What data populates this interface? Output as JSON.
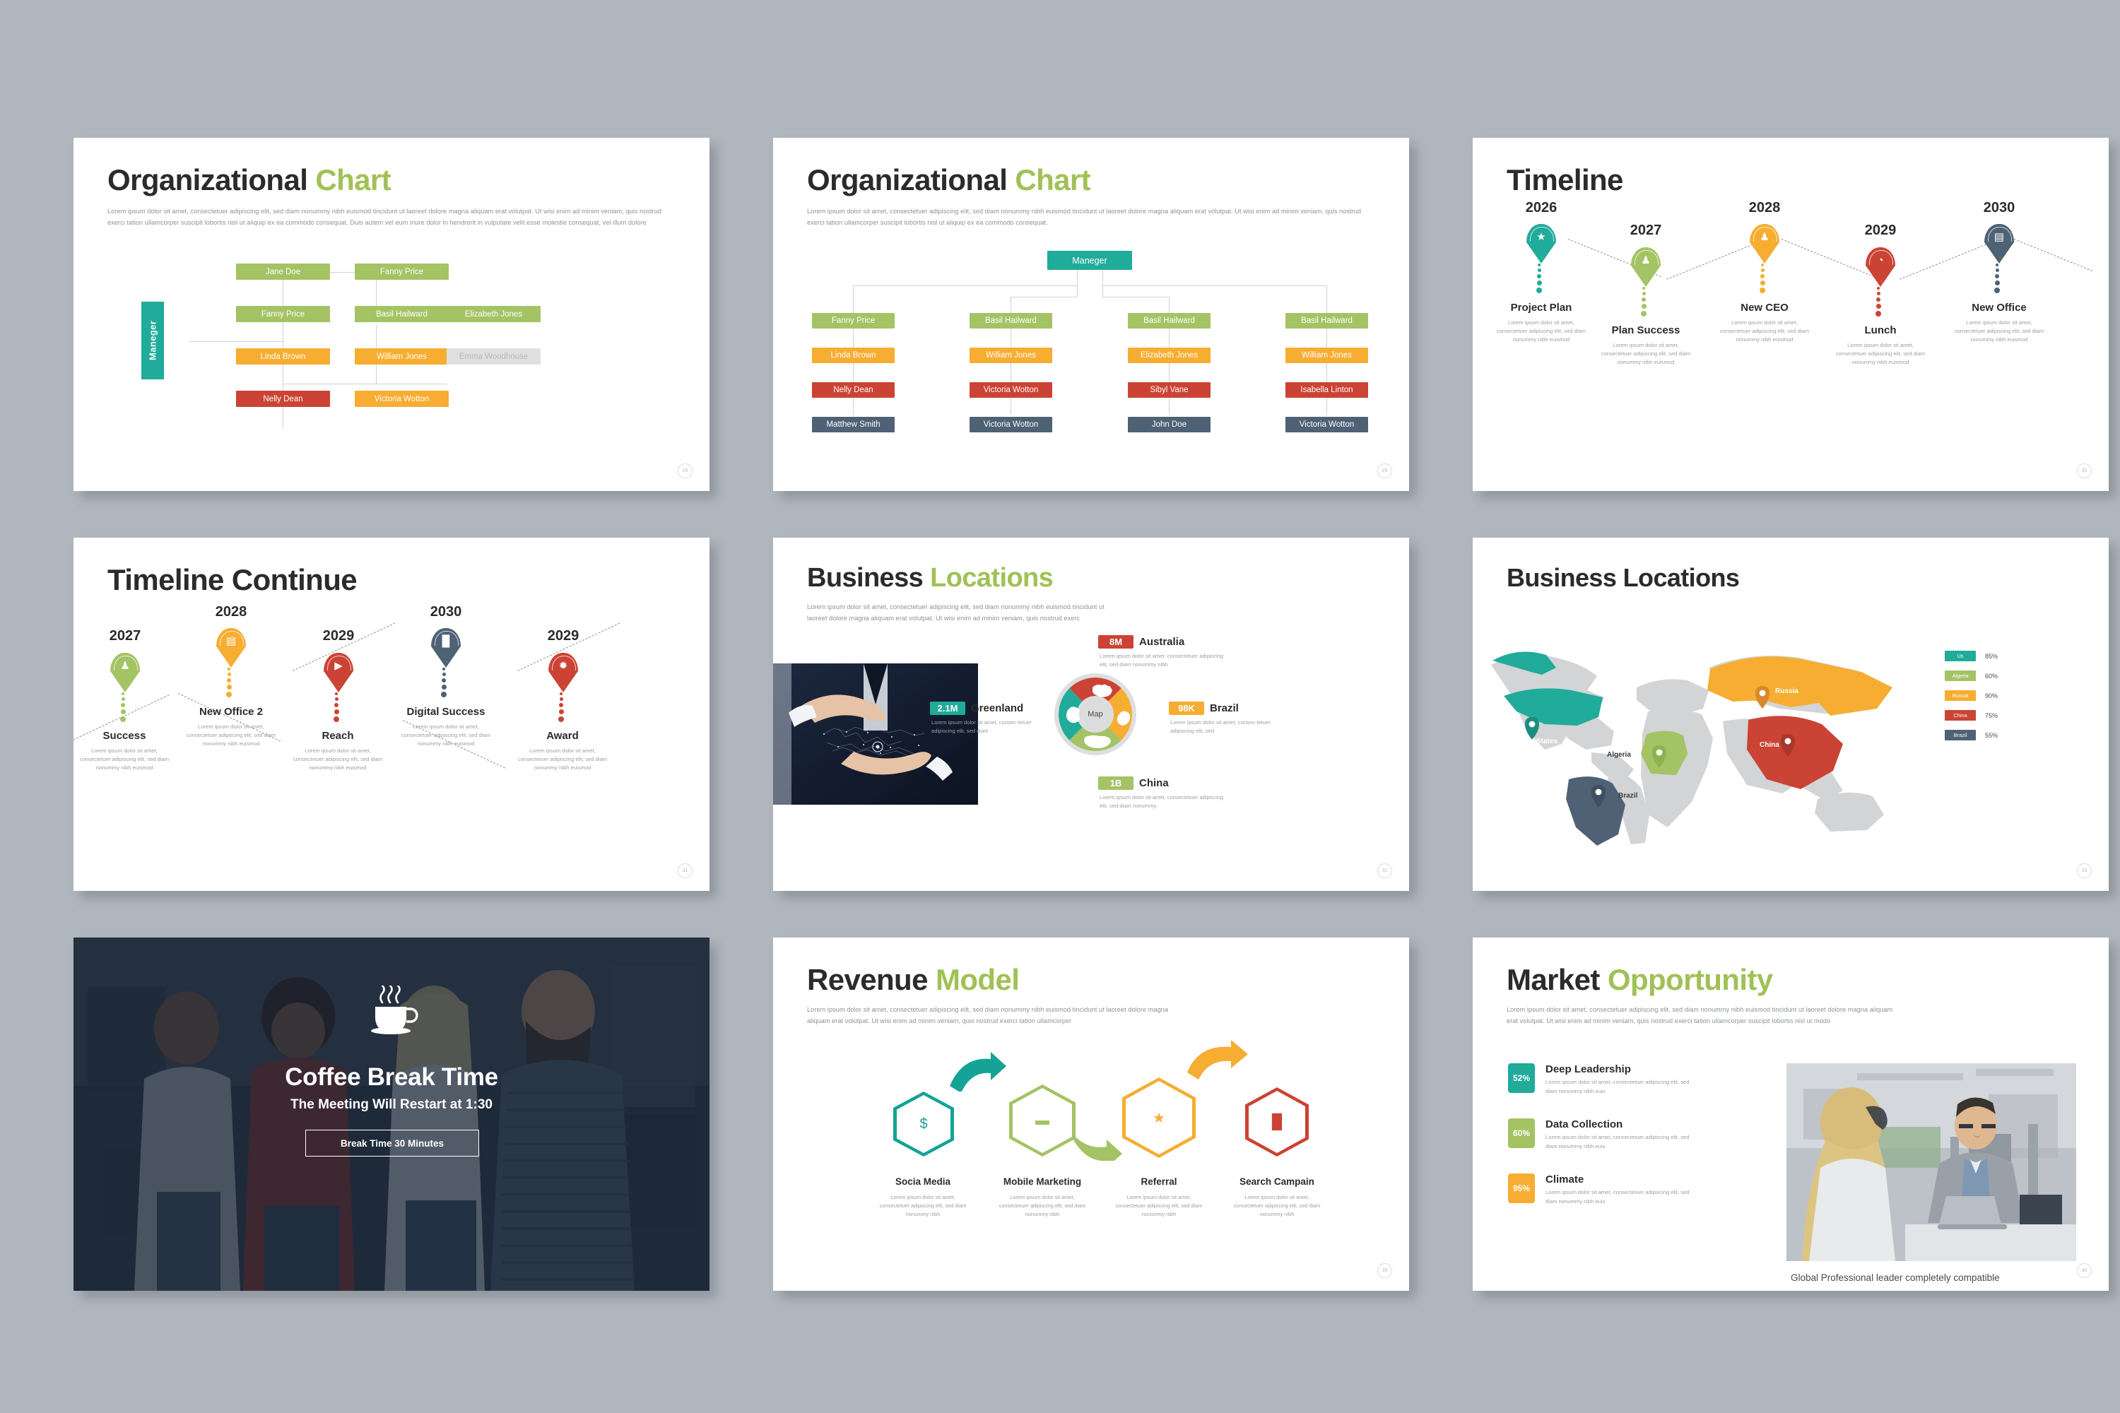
{
  "theme": {
    "teal": "#20ab9b",
    "green": "#a4c364",
    "orange": "#f6ad31",
    "red": "#cb4334",
    "slate": "#4f6175",
    "grey": "#e0e0e0",
    "accent_title": "#a0c156",
    "background": "#b0b6bd"
  },
  "slides": [
    {
      "id": "org-chart-1",
      "page": "28",
      "title_main": "Organizational",
      "title_accent": "Chart",
      "body": "Lorem ipsum dolor sit amet, consectetuer adipiscing elit, sed diam nonummy nibh euismod tincidunt ut laoreet dolore magna aliquam erat volutpat. Ut wisi enim ad minim veniam, quis nostrud exerci tation ullamcorper suscipit lobortis nisl ut aliquip ex ea commodo consequat. Duis autem vel eum iriure dolor in hendrerit in vulputate velit esse molestie consequat, vel illum dolore",
      "manager_label": "Maneger",
      "nodes": [
        {
          "label": "Jane Doe",
          "color": "green"
        },
        {
          "label": "Fanny Price",
          "color": "green"
        },
        {
          "label": "Elizabeth Jones",
          "color": "green"
        },
        {
          "label": "Fanny Price",
          "color": "green"
        },
        {
          "label": "Basil Hailward",
          "color": "green"
        },
        {
          "label": "Linda Brown",
          "color": "orange"
        },
        {
          "label": "William Jones",
          "color": "orange"
        },
        {
          "label": "Emma Woodhouse",
          "color": "grey"
        },
        {
          "label": "Nelly Dean",
          "color": "red"
        },
        {
          "label": "Victoria Wotton",
          "color": "orange"
        }
      ]
    },
    {
      "id": "org-chart-2",
      "page": "29",
      "title_main": "Organizational",
      "title_accent": "Chart",
      "body": "Lorem ipsum dolor sit amet, consectetuer adipiscing elit, sed diam nonummy nibh euismod tincidunt ut laoreet dolore magna aliquam erat volutpat. Ut wisi enim ad minim veniam, quis nostrud exerci tation ullamcorper suscipit lobortis nisl ut aliquip ex ea commodo consequat.",
      "root": "Maneger",
      "columns": [
        {
          "green": "Fanny Price",
          "orange": "Linda Brown",
          "red": "Nelly Dean",
          "slate": "Matthew Smith"
        },
        {
          "green": "Basil Hailward",
          "orange": "William Jones",
          "red": "Victoria Wotton",
          "slate": "Victoria Wotton"
        },
        {
          "green": "Basil Hailward",
          "orange": "Elizabeth Jones",
          "red": "Sibyl Vane",
          "slate": "John Doe"
        },
        {
          "green": "Basil Hailward",
          "orange": "William Jones",
          "red": "Isabella Linton",
          "slate": "Victoria Wotton"
        }
      ]
    },
    {
      "id": "timeline",
      "page": "30",
      "title_main": "Timeline",
      "items": [
        {
          "year": "2026",
          "label": "Project Plan",
          "icon": "handshake-award-icon",
          "glyph": "★",
          "color": "teal",
          "desc": "Lorem ipsum dolor sit amet, consectetuer adipiscing elit, sed diam nonummy nibh euismod"
        },
        {
          "year": "2027",
          "label": "Plan Success",
          "icon": "trophy-person-icon",
          "glyph": "♟",
          "color": "green",
          "desc": "Lorem ipsum dolor sit amet, consectetuer adipiscing elit, sed diam nonummy nibh euismod"
        },
        {
          "year": "2028",
          "label": "New CEO",
          "icon": "podium-speaker-icon",
          "glyph": "♟",
          "color": "orange",
          "desc": "Lorem ipsum dolor sit amet, consectetuer adipiscing elit, sed diam nonummy nibh euismod"
        },
        {
          "year": "2029",
          "label": "Lunch",
          "icon": "rocket-launch-icon",
          "glyph": "◔",
          "color": "red",
          "desc": "Lorem ipsum dolor sit amet, consectetuer adipiscing elit, sed diam nonummy nibh euismod"
        },
        {
          "year": "2030",
          "label": "New Office",
          "icon": "building-icon",
          "glyph": "▤",
          "color": "slate",
          "desc": "Lorem ipsum dolor sit amet, consectetuer adipiscing elit, sed diam nonummy nibh euismod"
        }
      ]
    },
    {
      "id": "timeline-continue",
      "page": "31",
      "title_main": "Timeline Continue",
      "items": [
        {
          "year": "2027",
          "label": "Success",
          "icon": "person-flag-icon",
          "glyph": "♟",
          "color": "green",
          "desc": "Lorem ipsum dolor sit amet, consectetuer adipiscing elit, sed diam nonummy nibh euismod"
        },
        {
          "year": "2028",
          "label": "New Office 2",
          "icon": "briefcase-icon",
          "glyph": "▤",
          "color": "orange",
          "desc": "Lorem ipsum dolor sit amet, consectetuer adipiscing elit, sed diam nonummy nibh euismod"
        },
        {
          "year": "2029",
          "label": "Reach",
          "icon": "megaphone-icon",
          "glyph": "▶",
          "color": "red",
          "desc": "Lorem ipsum dolor sit amet, consectetuer adipiscing elit, sed diam nonummy nibh euismod"
        },
        {
          "year": "2030",
          "label": "Digital Success",
          "icon": "bar-chart-icon",
          "glyph": "█",
          "color": "slate",
          "desc": "Lorem ipsum dolor sit amet, consectetuer adipiscing elit, sed diam nonummy nibh euismod"
        },
        {
          "year": "2029",
          "label": "Award",
          "icon": "medal-ribbon-icon",
          "glyph": "✹",
          "color": "red",
          "desc": "Lorem ipsum dolor sit amet, consectetuer adipiscing elit, sed diam nonummy nibh euismod"
        }
      ]
    },
    {
      "id": "business-locations-donut",
      "page": "32",
      "title_main": "Business",
      "title_accent": "Locations",
      "body": "Lorem ipsum dolor sit amet, consectetuer adipiscing elit, sed diam nonummy nibh euismod tincidunt ut laoreet dolore magna aliquam erat volutpat. Ut wisi enim ad minim veniam, quis nostrud exerc",
      "hub_label": "Map",
      "segments": [
        {
          "value": "8M",
          "name": "Australia",
          "color": "red",
          "desc": "Lorem ipsum dolor sit amet, consectetuer adipiscing elit, sed diam nonummy nibh"
        },
        {
          "value": "98K",
          "name": "Brazil",
          "color": "orange",
          "desc": "Lorem ipsum dolor sit amet, consec-tetuer adipiscing elit, sed"
        },
        {
          "value": "1B",
          "name": "China",
          "color": "green",
          "desc": "Lorem ipsum dolor sit amet, consectetuer adipiscing elit, sed diam nonummy"
        },
        {
          "value": "2.1M",
          "name": "Greenland",
          "color": "teal",
          "desc": "Lorem ipsum dolor sit amet, consec-tetuer adipiscing elit, sed diam"
        }
      ]
    },
    {
      "id": "business-locations-map",
      "page": "33",
      "title_main": "Business Locations",
      "map_labels": [
        {
          "name": "United States",
          "color": "teal"
        },
        {
          "name": "Algeria",
          "color": "green"
        },
        {
          "name": "Russia",
          "color": "orange"
        },
        {
          "name": "China",
          "color": "red"
        },
        {
          "name": "Brazil",
          "color": "slate"
        }
      ],
      "legend": [
        {
          "label": "Us",
          "pct": "85%",
          "color": "teal"
        },
        {
          "label": "Algeria",
          "pct": "60%",
          "color": "green"
        },
        {
          "label": "Russia",
          "pct": "90%",
          "color": "orange"
        },
        {
          "label": "China",
          "pct": "75%",
          "color": "red"
        },
        {
          "label": "Brazil",
          "pct": "55%",
          "color": "slate"
        }
      ]
    },
    {
      "id": "coffee-break",
      "title": "Coffee Break Time",
      "subtitle": "The Meeting Will Restart at 1:30",
      "button": "Break Time 30 Minutes",
      "icon": "coffee-cup-icon"
    },
    {
      "id": "revenue-model",
      "page": "35",
      "title_main": "Revenue",
      "title_accent": "Model",
      "body": "Lorem ipsum dolor sit amet, consectetuer adipiscing elit, sed diam nonummy nibh euismod tincidunt ut laoreet dolore magna aliquam erat volutpat. Ut wisi enim ad minim veniam, quis nostrud exerci tation ullamcorper",
      "steps": [
        {
          "name": "Socia Media",
          "icon": "money-hand-icon",
          "glyph": "$",
          "color": "teal",
          "desc": "Lorem ipsum dolor sit amet, consectetuer adipiscing elit, sed diam nonummy nibh"
        },
        {
          "name": "Mobile Marketing",
          "icon": "briefcase-icon",
          "glyph": "▬",
          "color": "green",
          "desc": "Lorem ipsum dolor sit amet, consectetuer adipiscing elit, sed diam nonummy nibh"
        },
        {
          "name": "Referral",
          "icon": "handshake-stars-icon",
          "glyph": "★",
          "color": "orange",
          "desc": "Lorem ipsum dolor sit amet, consectetuer adipiscing elit, sed diam nonummy nibh"
        },
        {
          "name": "Search Campain",
          "icon": "growth-chart-icon",
          "glyph": "█",
          "color": "red",
          "desc": "Lorem ipsum dolor sit amet, consectetuer adipiscing elit, sed diam nonummy nibh"
        }
      ]
    },
    {
      "id": "market-opportunity",
      "page": "36",
      "title_main": "Market",
      "title_accent": "Opportunity",
      "body": "Lorem ipsum dolor sit amet, consectetuer adipiscing elit, sed diam nonummy nibh euismod tincidunt ut laoreet dolore magna aliquam erat volutpat. Ut wisi enim ad minim veniam, quis nostrud exerci tation ullamcorper suscipit lobortis nisl ut modo",
      "caption": "Global Professional leader completely compatible",
      "metrics": [
        {
          "pct": "52%",
          "title": "Deep Leadership",
          "color": "teal",
          "desc": "Lorem ipsum dolor sit amet, consectetuer adipiscing elit, sed diam nonummy nibh euis"
        },
        {
          "pct": "60%",
          "title": "Data Collection",
          "color": "green",
          "desc": "Lorem ipsum dolor sit amet, consectetuer adipiscing elit, sed diam nonummy nibh euis"
        },
        {
          "pct": "95%",
          "title": "Climate",
          "color": "orange",
          "desc": "Lorem ipsum dolor sit amet, consectetuer adipiscing elit, sed diam nonummy nibh euis"
        }
      ]
    }
  ],
  "chart_data": [
    {
      "type": "pie",
      "title": "Business Locations",
      "categories": [
        "Australia",
        "Brazil",
        "China",
        "Greenland"
      ],
      "labels": [
        "8M",
        "98K",
        "1B",
        "2.1M"
      ],
      "values": [
        25,
        25,
        25,
        25
      ],
      "colors": [
        "#cb4334",
        "#f6ad31",
        "#a4c364",
        "#20ab9b"
      ],
      "center_label": "Map",
      "legend": "around"
    },
    {
      "type": "bar",
      "title": "Business Locations coverage",
      "categories": [
        "Us",
        "Algeria",
        "Russia",
        "China",
        "Brazil"
      ],
      "values": [
        85,
        60,
        90,
        75,
        55
      ],
      "ylabel": "%",
      "ylim": [
        0,
        100
      ],
      "colors": [
        "#20ab9b",
        "#a4c364",
        "#f6ad31",
        "#cb4334",
        "#4f6175"
      ]
    },
    {
      "type": "bar",
      "title": "Market Opportunity",
      "categories": [
        "Deep Leadership",
        "Data Collection",
        "Climate"
      ],
      "values": [
        52,
        60,
        95
      ],
      "ylabel": "%",
      "ylim": [
        0,
        100
      ],
      "colors": [
        "#20ab9b",
        "#a4c364",
        "#f6ad31"
      ]
    }
  ]
}
